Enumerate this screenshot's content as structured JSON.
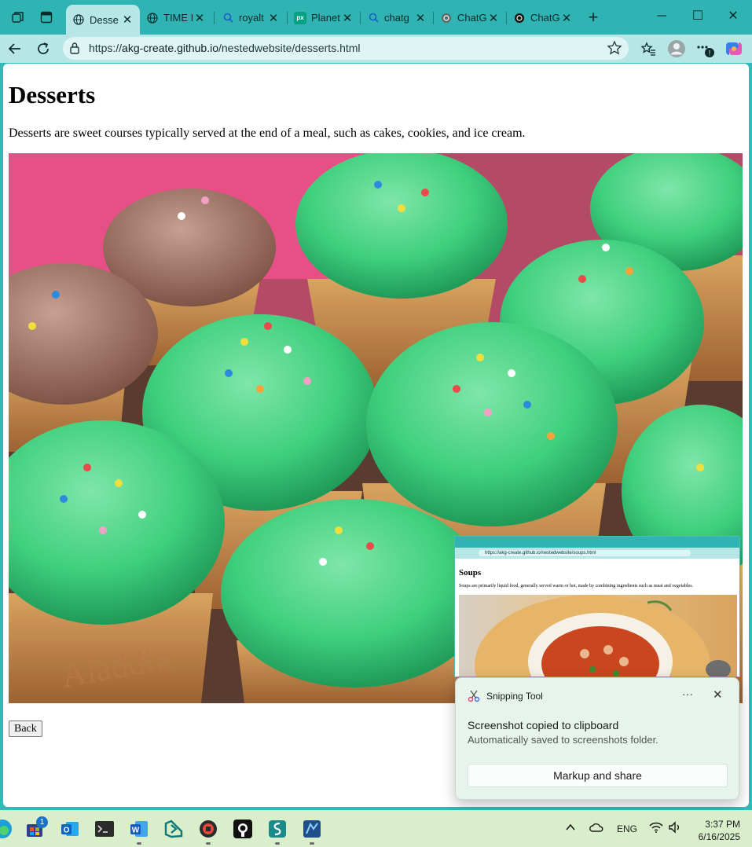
{
  "browser": {
    "tabs": [
      {
        "label": "Desse",
        "active": true
      },
      {
        "label": "TIME I"
      },
      {
        "label": "royalt"
      },
      {
        "label": "Planet"
      },
      {
        "label": "chatg"
      },
      {
        "label": "ChatG"
      },
      {
        "label": "ChatG"
      }
    ],
    "close_glyph": "✕",
    "new_tab_glyph": "+",
    "window_controls": {
      "minimize": "─",
      "maximize": "☐",
      "close": "✕"
    },
    "address": {
      "prefix": "https://",
      "host": "akg-create.github.io",
      "path": "/nestedwebsite/desserts.html"
    }
  },
  "page": {
    "title": "Desserts",
    "description": "Desserts are sweet courses typically served at the end of a meal, such as cakes, cookies, and ice cream.",
    "image": {
      "subject": "green frosted cupcakes in waffle cones with rainbow sprinkles",
      "cone_text": "Aladdin"
    },
    "back_label": "Back"
  },
  "preview": {
    "title": "Soups",
    "description": "Soups are primarily liquid food, generally served warm or hot, made by combining ingredients such as meat and vegetables.",
    "url": "https://akg-create.github.io/nestedwebsite/soups.html"
  },
  "toast": {
    "app_name": "Snipping Tool",
    "more": "···",
    "close": "✕",
    "message": "Screenshot copied to clipboard",
    "detail": "Automatically saved to screenshots folder.",
    "action": "Markup and share"
  },
  "taskbar": {
    "mail_badge": "1",
    "tray": {
      "language": "ENG"
    },
    "clock": {
      "time": "3:37 PM",
      "date": "6/16/2025"
    }
  },
  "colors": {
    "chrome": "#2fb3b3",
    "active_tab": "#b6e6e6",
    "frosting": "#3fcf7e",
    "taskbar": "#d9eecb",
    "toast": "#e6f4ec"
  }
}
